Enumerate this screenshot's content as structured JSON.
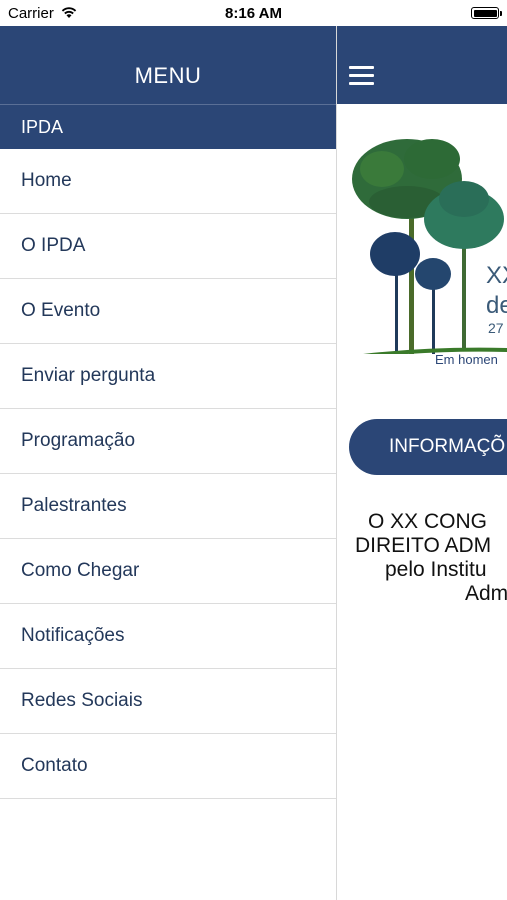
{
  "status_bar": {
    "carrier": "Carrier",
    "time": "8:16 AM"
  },
  "menu": {
    "title": "MENU",
    "section": "IPDA",
    "items": [
      {
        "label": "Home"
      },
      {
        "label": "O IPDA"
      },
      {
        "label": "O Evento"
      },
      {
        "label": "Enviar pergunta"
      },
      {
        "label": "Programação"
      },
      {
        "label": "Palestrantes"
      },
      {
        "label": "Como Chegar"
      },
      {
        "label": "Notificações"
      },
      {
        "label": "Redes Sociais"
      },
      {
        "label": "Contato"
      }
    ]
  },
  "content": {
    "logo": {
      "line1": "XX",
      "line2": "de",
      "date": "27",
      "tribute": "Em homen"
    },
    "info_button": "INFORMAÇÕ",
    "intro_lines": [
      "O XX CONG",
      "DIREITO ADM",
      "pelo Institu",
      "Adm"
    ]
  },
  "colors": {
    "primary": "#2b4676",
    "text": "#23385a",
    "divider": "#dcdcdc"
  }
}
